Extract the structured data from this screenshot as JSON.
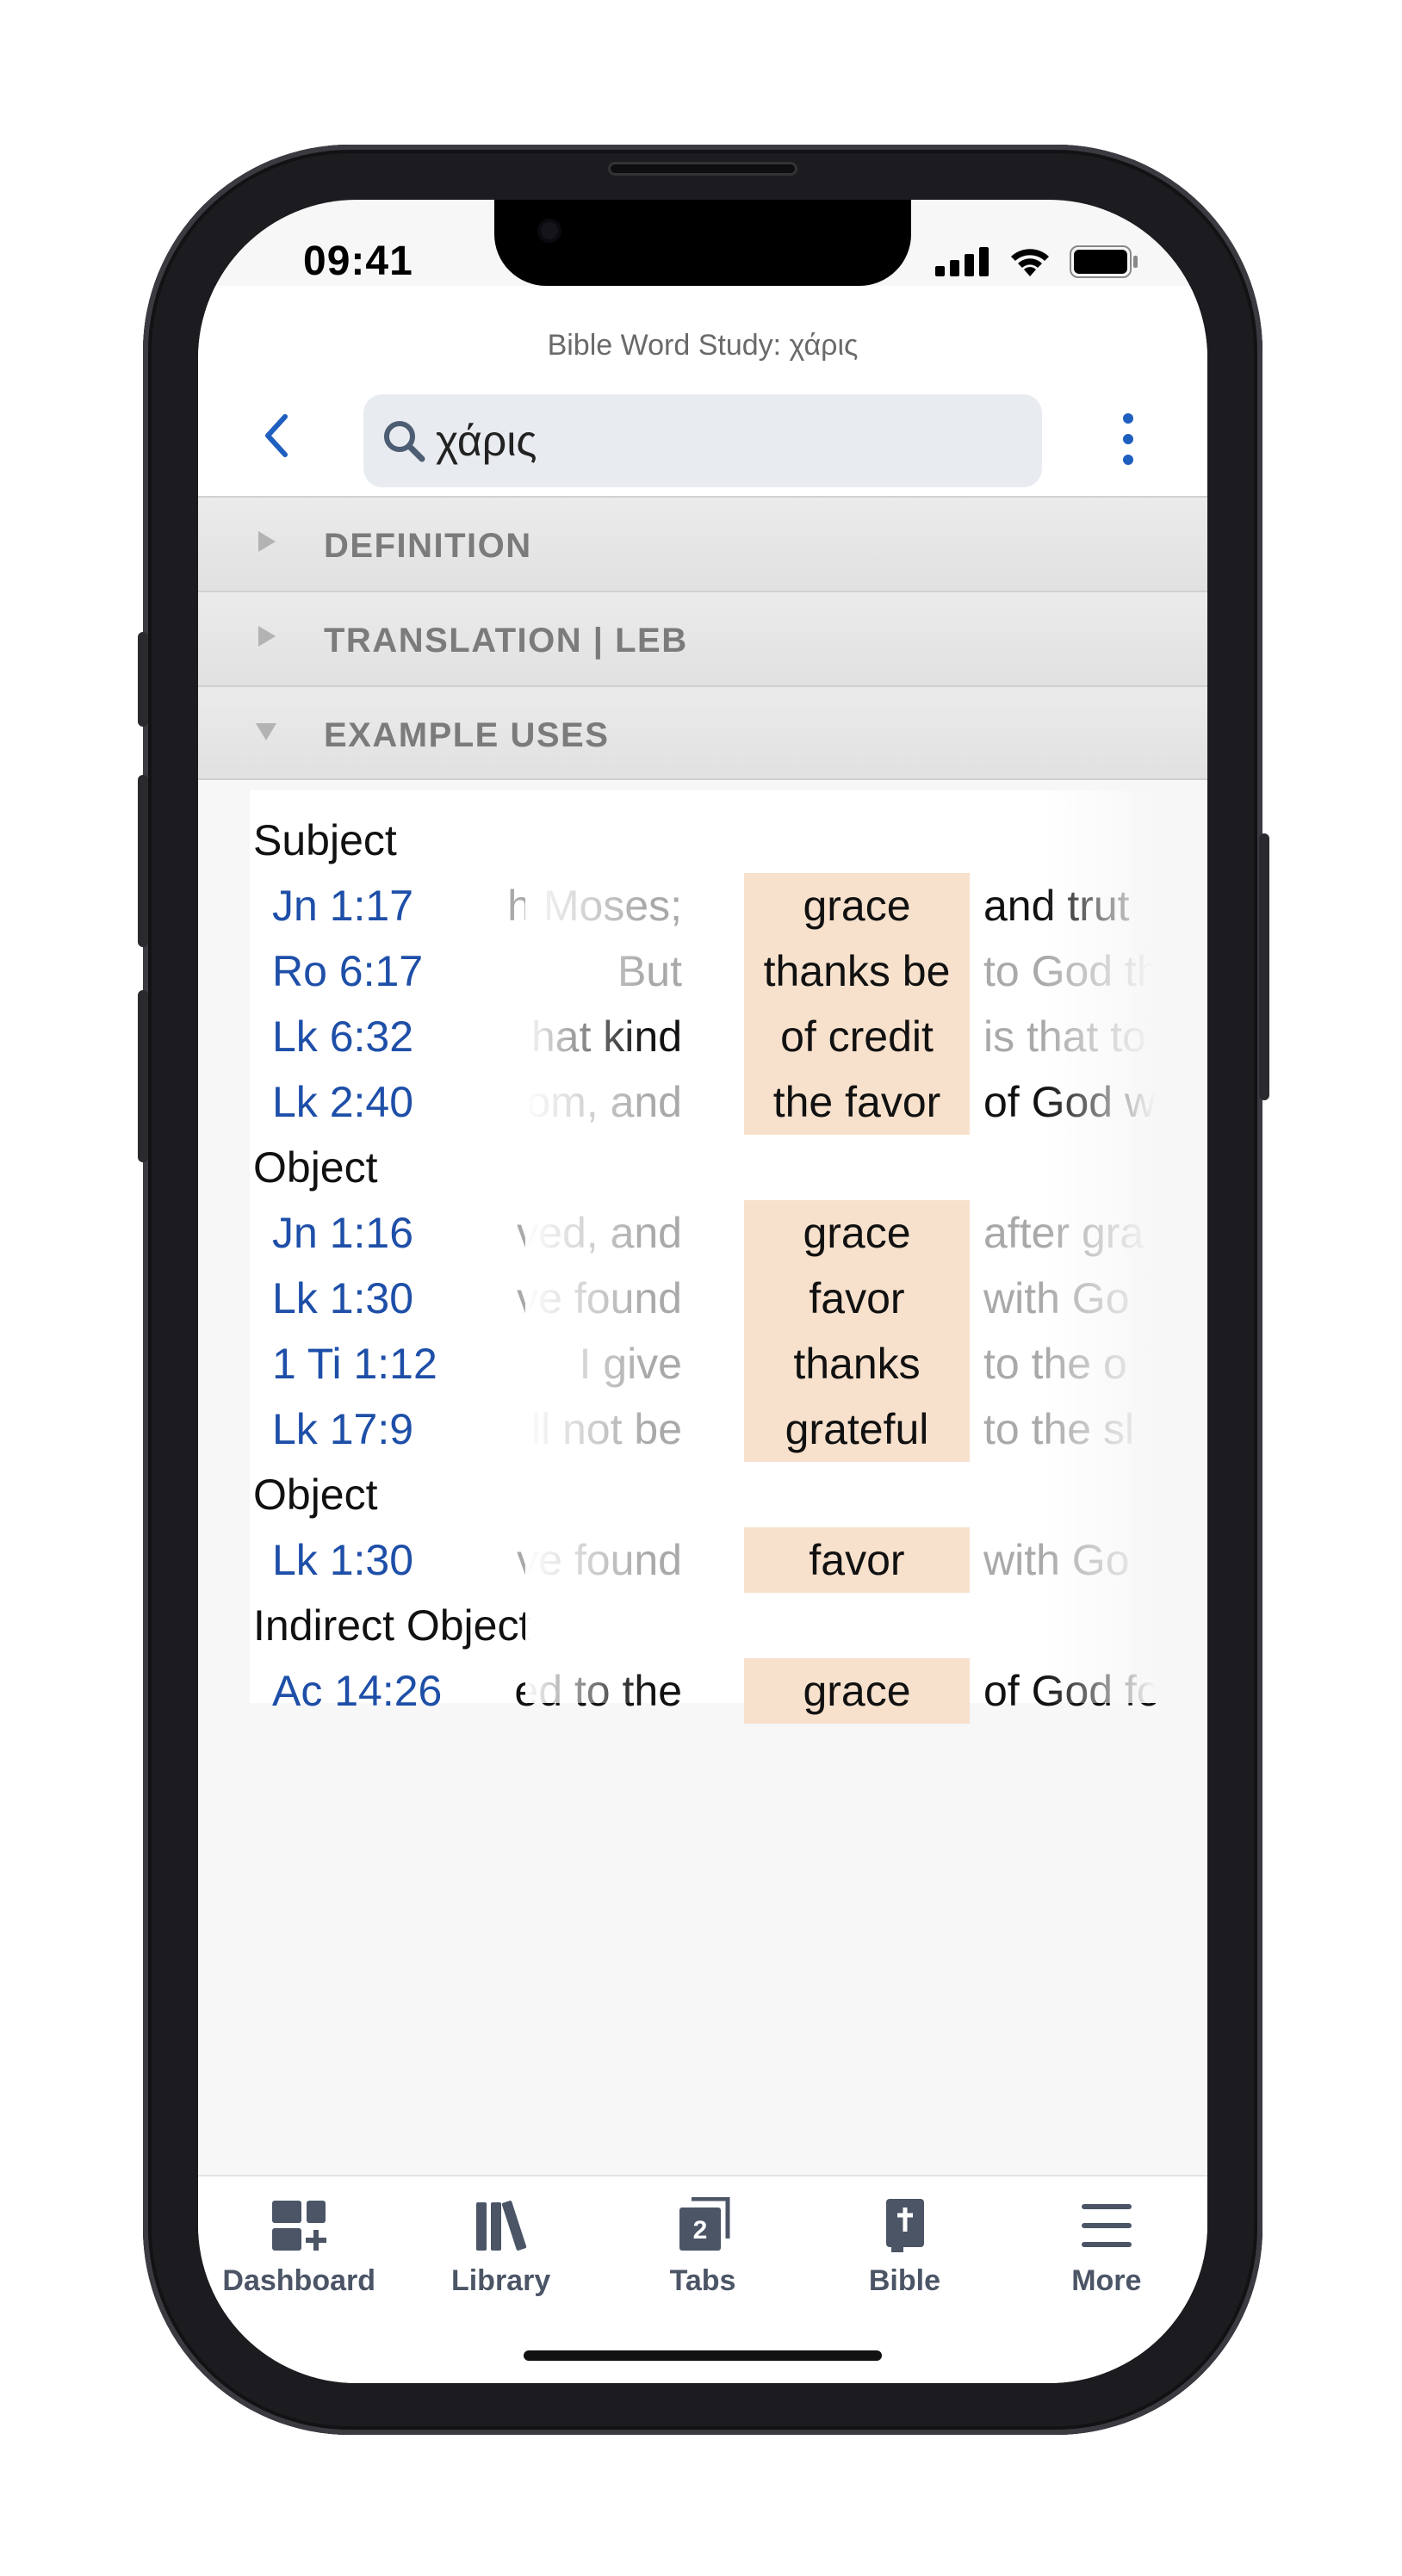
{
  "status_bar": {
    "time": "09:41"
  },
  "header": {
    "title": "Bible Word Study: χάρις",
    "search_value": "χάρις"
  },
  "sections": [
    {
      "label": "DEFINITION",
      "expanded": false
    },
    {
      "label": "TRANSLATION | LEB",
      "expanded": false
    },
    {
      "label": "EXAMPLE USES",
      "expanded": true
    }
  ],
  "example_uses": {
    "groups": [
      {
        "label": "Subject",
        "rows": [
          {
            "ref": "Jn 1:17",
            "left": "h Moses;",
            "kw": "grace",
            "right": "and trut"
          },
          {
            "ref": "Ro 6:17",
            "left": "But",
            "kw": "thanks be",
            "right": "to God th"
          },
          {
            "ref": "Lk 6:32",
            "left": "hat kind",
            "kw": "of credit",
            "right": "is that to"
          },
          {
            "ref": "Lk 2:40",
            "left": "om, and",
            "kw": "the favor",
            "right": "of God w"
          }
        ]
      },
      {
        "label": "Object",
        "rows": [
          {
            "ref": "Jn 1:16",
            "left": "ved, and",
            "kw": "grace",
            "right": "after gra"
          },
          {
            "ref": "Lk 1:30",
            "left": "ve found",
            "kw": "favor",
            "right": "with Go"
          },
          {
            "ref": "1 Ti 1:12",
            "left": "I give",
            "kw": "thanks",
            "right": "to the o"
          },
          {
            "ref": "Lk 17:9",
            "left": "ll not be",
            "kw": "grateful",
            "right": "to the sl"
          }
        ]
      },
      {
        "label": "Object",
        "rows": [
          {
            "ref": "Lk 1:30",
            "left": "ve found",
            "kw": "favor",
            "right": "with Go"
          }
        ]
      },
      {
        "label": "Indirect Object",
        "rows": [
          {
            "ref": "Ac 14:26",
            "left": "ed to the",
            "kw": "grace",
            "right": "of God fo"
          }
        ]
      }
    ]
  },
  "tabbar": [
    {
      "label": "Dashboard",
      "icon": "dashboard-icon"
    },
    {
      "label": "Library",
      "icon": "library-icon"
    },
    {
      "label": "Tabs",
      "icon": "tabs-icon",
      "badge": "2"
    },
    {
      "label": "Bible",
      "icon": "bible-icon"
    },
    {
      "label": "More",
      "icon": "more-icon"
    }
  ],
  "colors": {
    "accent": "#1f5fbf",
    "highlight": "#f7e1cc",
    "section_bg": "#e5e5e5",
    "tab_label": "#4b5566"
  }
}
